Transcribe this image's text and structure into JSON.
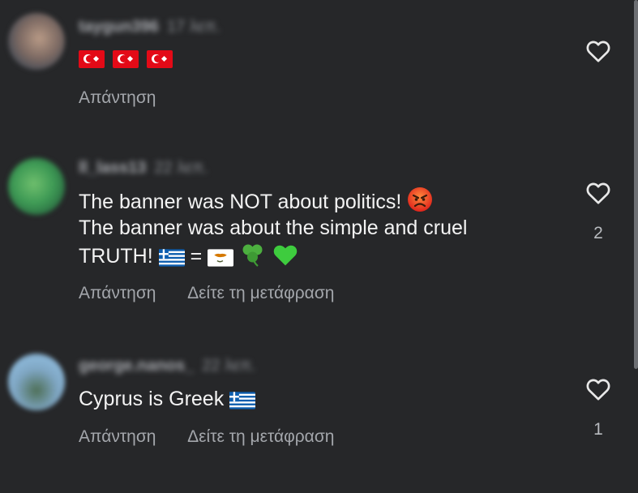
{
  "comments": [
    {
      "username": "taygun396",
      "time": "17 λεπ.",
      "text": "",
      "reply_label": "Απάντηση",
      "translate_label": "",
      "likes": ""
    },
    {
      "username": "ll_lass13",
      "time": "22 λεπ.",
      "text_line1": "The banner was NOT about politics!",
      "text_line2": "The banner was about the simple and cruel",
      "text_line3_start": "TRUTH!",
      "text_line3_eq": "=",
      "reply_label": "Απάντηση",
      "translate_label": "Δείτε τη μετάφραση",
      "likes": "2"
    },
    {
      "username": "george.nanos_",
      "time": "22 λεπ.",
      "text": "Cyprus is Greek",
      "reply_label": "Απάντηση",
      "translate_label": "Δείτε τη μετάφραση",
      "likes": "1"
    }
  ],
  "icons": {
    "heart": "heart-outline-icon",
    "flags": [
      "turkey-flag-icon",
      "greece-flag-icon",
      "cyprus-flag-icon"
    ],
    "emoji": [
      "angry-face-icon",
      "shamrock-icon",
      "green-heart-icon"
    ]
  },
  "colors": {
    "background": "#262729",
    "text": "#f3f3f3",
    "secondary": "#a3a6ab"
  }
}
